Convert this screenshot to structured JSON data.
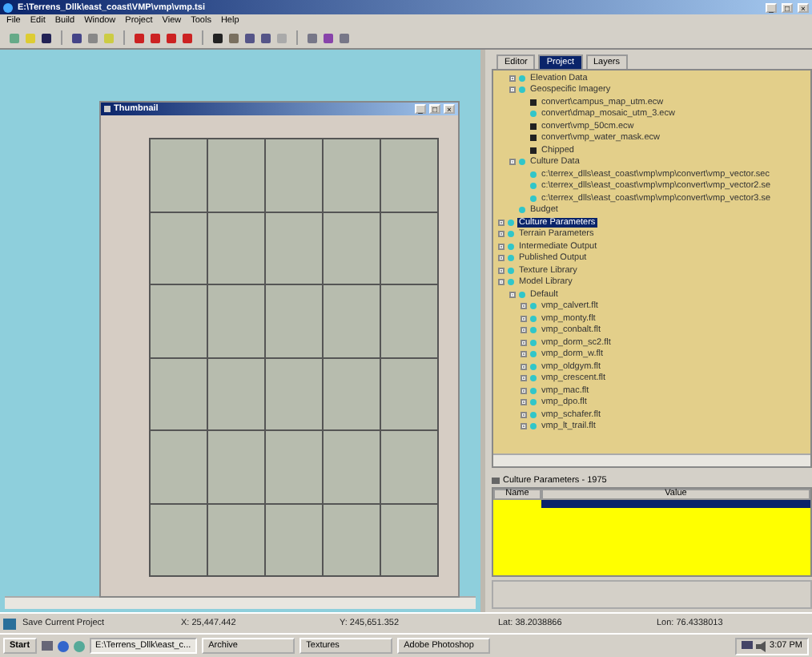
{
  "window": {
    "title": "E:\\Terrens_Dllk\\east_coast\\VMP\\vmp\\vmp.tsi",
    "buttons": [
      "_",
      "□",
      "×"
    ]
  },
  "menu": [
    "File",
    "Edit",
    "Build",
    "Window",
    "Project",
    "View",
    "Tools",
    "Help"
  ],
  "thumbnail": {
    "title": "Thumbnail",
    "buttons": [
      "_",
      "□",
      "×"
    ]
  },
  "tabs": [
    {
      "label": "Editor",
      "selected": false
    },
    {
      "label": "Project",
      "selected": true
    },
    {
      "label": "Layers",
      "selected": false
    }
  ],
  "tree": [
    {
      "label": "Elevation Data",
      "kind": "dot",
      "expanded": false,
      "selected": false
    },
    {
      "label": "Geospecific Imagery",
      "kind": "dot",
      "expanded": true,
      "selected": false,
      "children": [
        {
          "label": "convert\\campus_map_utm.ecw",
          "kind": "square",
          "selected": false
        },
        {
          "label": "convert\\dmap_mosaic_utm_3.ecw",
          "kind": "dot",
          "selected": false
        },
        {
          "label": "convert\\vmp_50cm.ecw",
          "kind": "square",
          "selected": false
        },
        {
          "label": "convert\\vmp_water_mask.ecw",
          "kind": "square",
          "selected": false
        },
        {
          "label": "Chipped",
          "kind": "square",
          "selected": false
        }
      ]
    },
    {
      "label": "Culture Data",
      "kind": "dot",
      "expanded": true,
      "selected": false,
      "children": [
        {
          "label": "c:\\terrex_dlls\\east_coast\\vmp\\vmp\\convert\\vmp_vector.sec",
          "kind": "dot",
          "selected": false
        },
        {
          "label": "c:\\terrex_dlls\\east_coast\\vmp\\vmp\\convert\\vmp_vector2.se",
          "kind": "dot",
          "selected": false
        },
        {
          "label": "c:\\terrex_dlls\\east_coast\\vmp\\vmp\\convert\\vmp_vector3.se",
          "kind": "dot",
          "selected": false
        }
      ]
    },
    {
      "label": "Budget",
      "kind": "dot",
      "selected": false
    }
  ],
  "tree_root": [
    {
      "label": "Culture Parameters",
      "kind": "dot",
      "expanded": false,
      "selected": true
    },
    {
      "label": "Terrain Parameters",
      "kind": "dot",
      "expanded": false,
      "selected": false
    },
    {
      "label": "Intermediate Output",
      "kind": "dot",
      "expanded": false,
      "selected": false
    },
    {
      "label": "Published Output",
      "kind": "dot",
      "expanded": false,
      "selected": false
    },
    {
      "label": "Texture Library",
      "kind": "dot",
      "expanded": false,
      "selected": false
    },
    {
      "label": "Model Library",
      "kind": "dot",
      "expanded": true,
      "selected": false,
      "children": [
        {
          "label": "Default",
          "kind": "dot",
          "expanded": true,
          "selected": false,
          "children": [
            {
              "label": "vmp_calvert.flt",
              "kind": "dot",
              "expanded": false,
              "selected": false
            },
            {
              "label": "vmp_monty.flt",
              "kind": "dot",
              "expanded": false,
              "selected": false
            },
            {
              "label": "vmp_conbalt.flt",
              "kind": "dot",
              "expanded": false,
              "selected": false
            },
            {
              "label": "vmp_dorm_sc2.flt",
              "kind": "dot",
              "expanded": false,
              "selected": false
            },
            {
              "label": "vmp_dorm_w.flt",
              "kind": "dot",
              "expanded": false,
              "selected": false
            },
            {
              "label": "vmp_oldgym.flt",
              "kind": "dot",
              "expanded": false,
              "selected": false
            },
            {
              "label": "vmp_crescent.flt",
              "kind": "dot",
              "expanded": false,
              "selected": false
            },
            {
              "label": "vmp_mac.flt",
              "kind": "dot",
              "expanded": false,
              "selected": false
            },
            {
              "label": "vmp_dpo.flt",
              "kind": "dot",
              "expanded": false,
              "selected": false
            },
            {
              "label": "vmp_schafer.flt",
              "kind": "dot",
              "expanded": false,
              "selected": false
            },
            {
              "label": "vmp_lt_trail.flt",
              "kind": "dot",
              "expanded": false,
              "selected": false
            }
          ]
        }
      ]
    }
  ],
  "properties": {
    "title": "Culture Parameters - 1975",
    "columns": [
      "Name",
      "Value"
    ],
    "rows": [
      {
        "selected": true
      }
    ]
  },
  "status_bar": [
    "Save Current Project",
    "X: 25,447.442",
    "Y: 245,651.352",
    "Lat: 38.2038866",
    "Lon: 76.4338013"
  ],
  "taskbar": {
    "start": "Start",
    "tasks": [
      {
        "label": "E:\\Terrens_Dllk\\east_c...",
        "selected": true
      },
      {
        "label": "Archive",
        "selected": false
      },
      {
        "label": "Textures",
        "selected": false
      },
      {
        "label": "Adobe Photoshop",
        "selected": false
      }
    ],
    "clock": "3:07 PM"
  }
}
